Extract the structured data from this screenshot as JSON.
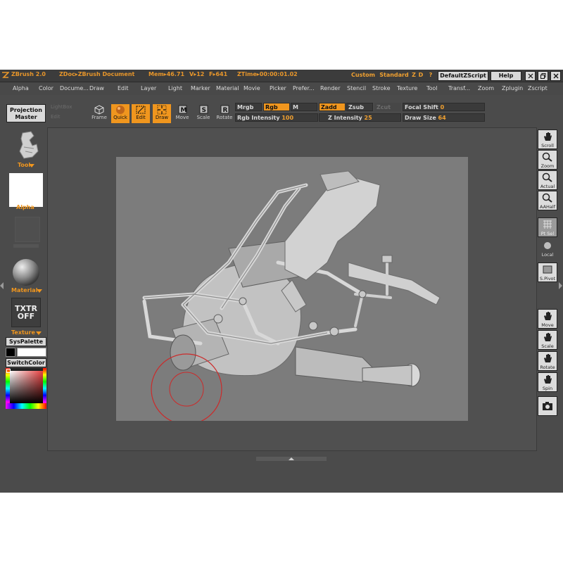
{
  "title_bar": {
    "app_name": "ZBrush 2.0",
    "document_label": "ZDoc▸ZBrush Document",
    "mem_label": "Mem▸46.71",
    "v_label": "V▸12",
    "f_label": "F▸641",
    "ztime_label": "ZTime▸00:00:01.02",
    "custom_label": "Custom",
    "standard_label": "Standard",
    "z_label": "Z",
    "d_label": "D",
    "question_label": "?",
    "default_zscript_label": "DefaultZScript",
    "help_label": "Help",
    "minimize_label": "✕",
    "restore_label": "❐",
    "close_label": "✕"
  },
  "menu": {
    "items": [
      "Alpha",
      "Color",
      "Docume...",
      "Draw",
      "Edit",
      "Layer",
      "Light",
      "Marker",
      "Material",
      "Movie",
      "Picker",
      "Prefer...",
      "Render",
      "Stencil",
      "Stroke",
      "Texture",
      "Tool",
      "Transf...",
      "Zoom",
      "Zplugin",
      "Zscript"
    ]
  },
  "shelf": {
    "projection_master": "Projection Master",
    "ghost_left_1": "LightBox",
    "ghost_left_2": "Edit",
    "frame_label": "Frame",
    "quick_label": "Quick",
    "edit_label": "Edit",
    "draw_label": "Draw",
    "move_label": "Move",
    "scale_label": "Scale",
    "rotate_label": "Rotate",
    "mrgb_label": "Mrgb",
    "rgb_label": "Rgb",
    "m_label": "M",
    "zadd_label": "Zadd",
    "zsub_label": "Zsub",
    "zcut_label": "Zcut",
    "rgb_intensity_label": "Rgb Intensity",
    "rgb_intensity_value": "100",
    "z_intensity_label": "Z Intensity",
    "z_intensity_value": "25",
    "focal_shift_label": "Focal Shift",
    "focal_shift_value": "0",
    "draw_size_label": "Draw Size",
    "draw_size_value": "64"
  },
  "left_tray": {
    "tool_label": "Tool",
    "alpha_label": "Alpha",
    "material_label": "Material",
    "txtr_label": "TXTR",
    "off_label": "OFF",
    "texture_label": "Texture",
    "syspalette_label": "SysPalette",
    "switchcolor_label": "SwitchColor"
  },
  "right_tray": {
    "scroll": "Scroll",
    "zoom": "Zoom",
    "actual": "Actual",
    "aahalf": "AAHalf",
    "ptsel": "Pt Sel",
    "local": "Local",
    "spivot": "S.Pivot",
    "move": "Move",
    "scale": "Scale",
    "rotate": "Rotate",
    "spin": "Spin",
    "camera": "camera-icon"
  },
  "colors": {
    "accent": "#f0961e",
    "panel": "#4b4b4b",
    "canvas": "#7c7c7c",
    "brush_cursor": "#cc2a2a"
  }
}
